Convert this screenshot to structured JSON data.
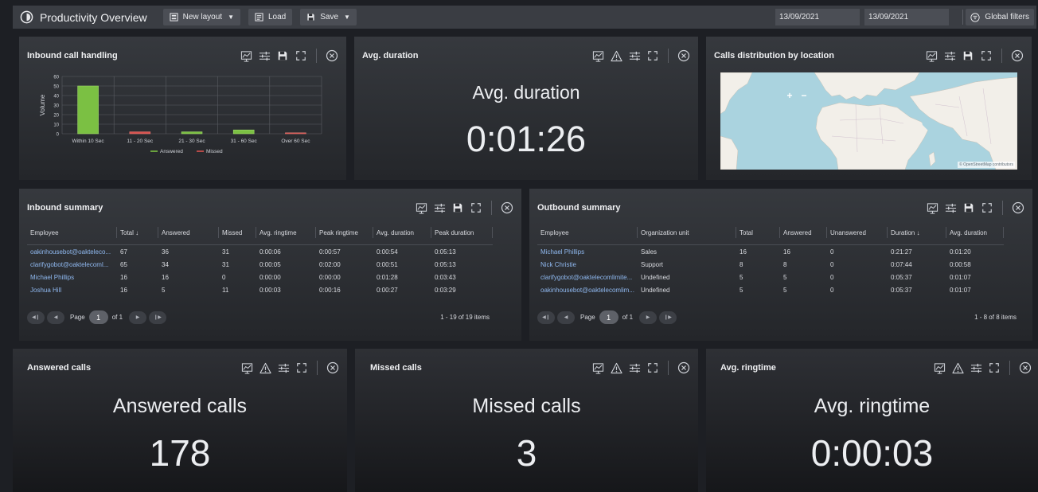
{
  "header": {
    "title": "Productivity Overview",
    "new_layout": "New layout",
    "load": "Load",
    "save": "Save",
    "date_from": "13/09/2021",
    "date_to": "13/09/2021",
    "global_filters": "Global filters"
  },
  "panels": {
    "inbound_call_handling": {
      "title": "Inbound call handling"
    },
    "avg_duration": {
      "title": "Avg. duration",
      "label": "Avg. duration",
      "value": "0:01:26"
    },
    "calls_distribution": {
      "title": "Calls distribution by location",
      "zoom_in": "+",
      "zoom_out": "−",
      "attribution": "© OpenStreetMap contributors"
    },
    "inbound_summary": {
      "title": "Inbound summary",
      "columns": [
        "Employee",
        "Total ↓",
        "Answered",
        "Missed",
        "Avg. ringtime",
        "Peak ringtime",
        "Avg. duration",
        "Peak duration"
      ],
      "rows": [
        [
          "oakinhousebot@oakteleco...",
          "67",
          "36",
          "31",
          "0:00:06",
          "0:00:57",
          "0:00:54",
          "0:05:13"
        ],
        [
          "clarifygobot@oaktelecoml...",
          "65",
          "34",
          "31",
          "0:00:05",
          "0:02:00",
          "0:00:51",
          "0:05:13"
        ],
        [
          "Michael Phillips",
          "16",
          "16",
          "0",
          "0:00:00",
          "0:00:00",
          "0:01:28",
          "0:03:43"
        ],
        [
          "Joshua Hill",
          "16",
          "5",
          "11",
          "0:00:03",
          "0:00:16",
          "0:00:27",
          "0:03:29"
        ]
      ],
      "page_label": "Page",
      "page": "1",
      "of_label": "of 1",
      "items_info": "1 - 19 of 19 items"
    },
    "outbound_summary": {
      "title": "Outbound summary",
      "columns": [
        "Employee",
        "Organization unit",
        "Total",
        "Answered",
        "Unanswered",
        "Duration ↓",
        "Avg. duration"
      ],
      "rows": [
        [
          "Michael Phillips",
          "Sales",
          "16",
          "16",
          "0",
          "0:21:27",
          "0:01:20"
        ],
        [
          "Nick Christie",
          "Support",
          "8",
          "8",
          "0",
          "0:07:44",
          "0:00:58"
        ],
        [
          "clarifygobot@oaktelecomlimite...",
          "Undefined",
          "5",
          "5",
          "0",
          "0:05:37",
          "0:01:07"
        ],
        [
          "oakinhousebot@oaktelecomlim...",
          "Undefined",
          "5",
          "5",
          "0",
          "0:05:37",
          "0:01:07"
        ]
      ],
      "page_label": "Page",
      "page": "1",
      "of_label": "of 1",
      "items_info": "1 - 8 of 8 items"
    },
    "answered_calls": {
      "title": "Answered calls",
      "label": "Answered calls",
      "value": "178"
    },
    "missed_calls": {
      "title": "Missed calls",
      "label": "Missed calls",
      "value": "3"
    },
    "avg_ringtime": {
      "title": "Avg. ringtime",
      "label": "Avg. ringtime",
      "value": "0:00:03"
    }
  },
  "icons": {
    "toolbar": [
      "chart-type-icon",
      "alert-icon",
      "settings-sliders-icon",
      "save-icon",
      "fullscreen-icon",
      "close-circle-icon"
    ]
  },
  "colors": {
    "answered": "#7bc043",
    "missed": "#d9534f",
    "link": "#8fb8ef"
  },
  "chart_data": {
    "type": "bar",
    "categories": [
      "Within 10 Sec",
      "11 - 20 Sec",
      "21 - 30 Sec",
      "31 - 60 Sec",
      "Over 60 Sec"
    ],
    "series": [
      {
        "name": "Answered",
        "values": [
          50,
          0,
          2,
          4,
          0
        ]
      },
      {
        "name": "Missed",
        "values": [
          0,
          2,
          0,
          0,
          1
        ]
      }
    ],
    "ylabel": "Volume",
    "yticks": [
      0,
      10,
      20,
      30,
      40,
      50,
      60
    ],
    "ylim": [
      0,
      60
    ],
    "legend": "bottom",
    "grid": true
  }
}
